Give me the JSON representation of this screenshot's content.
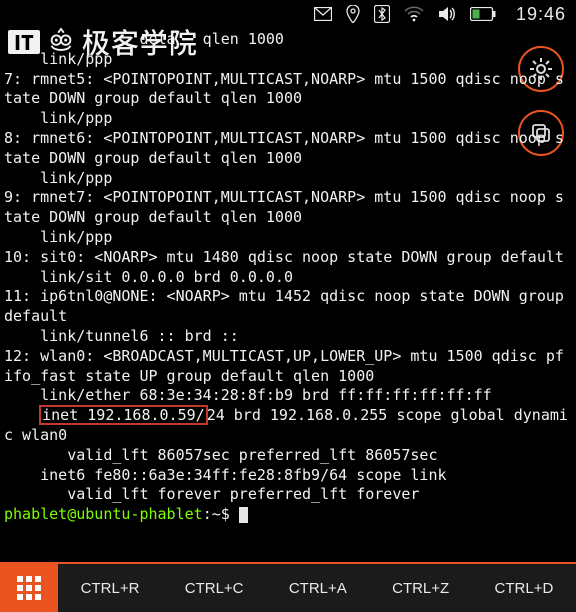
{
  "statusbar": {
    "time": "19:46",
    "icons": [
      "envelope",
      "location",
      "bluetooth",
      "wifi",
      "volume",
      "battery"
    ]
  },
  "logo": {
    "badge": "IT",
    "text": "极客学院"
  },
  "circle_buttons": {
    "settings": "settings",
    "copy": "copy"
  },
  "terminal": {
    "line_top": "               dela   qlen 1000",
    "linkppp": "    link/ppp",
    "if7": "7: rmnet5: <POINTOPOINT,MULTICAST,NOARP> mtu 1500 qdisc noop state DOWN group default qlen 1000",
    "if8": "8: rmnet6: <POINTOPOINT,MULTICAST,NOARP> mtu 1500 qdisc noop state DOWN group default qlen 1000",
    "if9": "9: rmnet7: <POINTOPOINT,MULTICAST,NOARP> mtu 1500 qdisc noop state DOWN group default qlen 1000",
    "if10": "10: sit0: <NOARP> mtu 1480 qdisc noop state DOWN group default",
    "if10_link": "    link/sit 0.0.0.0 brd 0.0.0.0",
    "if11": "11: ip6tnl0@NONE: <NOARP> mtu 1452 qdisc noop state DOWN group default",
    "if11_link": "    link/tunnel6 :: brd ::",
    "if12": "12: wlan0: <BROADCAST,MULTICAST,UP,LOWER_UP> mtu 1500 qdisc pfifo_fast state UP group default qlen 1000",
    "if12_mac": "    link/ether 68:3e:34:28:8f:b9 brd ff:ff:ff:ff:ff:ff",
    "if12_inet_pre": "    ",
    "if12_inet_hl": "inet 192.168.0.59/",
    "if12_inet_post": "24 brd 192.168.0.255 scope global dynamic wlan0",
    "if12_valid": "       valid_lft 86057sec preferred_lft 86057sec",
    "if12_inet6": "    inet6 fe80::6a3e:34ff:fe28:8fb9/64 scope link",
    "if12_valid2": "       valid_lft forever preferred_lft forever",
    "prompt_user": "phablet@ubuntu-phablet",
    "prompt_tail": ":~$ "
  },
  "keybar": {
    "keys": [
      "CTRL+R",
      "CTRL+C",
      "CTRL+A",
      "CTRL+Z",
      "CTRL+D"
    ]
  }
}
